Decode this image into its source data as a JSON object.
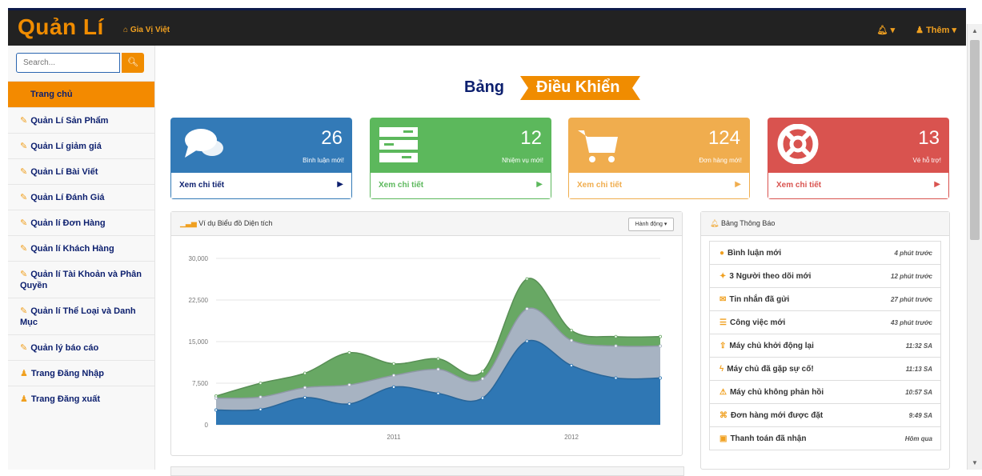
{
  "navbar": {
    "brand": "Quản Lí",
    "site_link": "Gia Vị Việt",
    "bell_label": "▾",
    "more_label": "Thêm ▾"
  },
  "sidebar": {
    "search_placeholder": "Search...",
    "items": [
      {
        "label": "Trang chủ",
        "icon": "none",
        "active": true
      },
      {
        "label": "Quản Lí Sản Phẩm",
        "icon": "edit-icon"
      },
      {
        "label": "Quản Lí giảm giá",
        "icon": "edit-icon"
      },
      {
        "label": "Quản Lí Bài Viết",
        "icon": "edit-icon"
      },
      {
        "label": "Quản Lí Đánh Giá",
        "icon": "edit-icon"
      },
      {
        "label": "Quản lí Đơn Hàng",
        "icon": "edit-icon"
      },
      {
        "label": "Quản lí Khách Hàng",
        "icon": "edit-icon"
      },
      {
        "label": "Quản lí Tài Khoản và Phân Quyền",
        "icon": "edit-icon"
      },
      {
        "label": "Quản lí Thể Loại và Danh Mục",
        "icon": "edit-icon"
      },
      {
        "label": "Quản lý báo cáo",
        "icon": "edit-icon"
      },
      {
        "label": "Trang Đăng Nhập",
        "icon": "user-icon"
      },
      {
        "label": "Trang Đăng xuất",
        "icon": "user-icon"
      }
    ]
  },
  "heading": {
    "word1": "Bảng",
    "word2": "Điều Khiển"
  },
  "cards": [
    {
      "count": "26",
      "label": "Bình luận mới!",
      "link": "Xem chi tiết",
      "color": "#337ab7",
      "icon": "comments-icon"
    },
    {
      "count": "12",
      "label": "Nhiệm vụ mới!",
      "link": "Xem chi tiết",
      "color": "#5cb85c",
      "icon": "tasks-icon"
    },
    {
      "count": "124",
      "label": "Đơn hàng mới!",
      "link": "Xem chi tiết",
      "color": "#f0ad4e",
      "icon": "cart-icon"
    },
    {
      "count": "13",
      "label": "Vé hỗ trợ!",
      "link": "Xem chi tiết",
      "color": "#d9534f",
      "icon": "support-icon"
    }
  ],
  "chart_panel": {
    "title": "Ví dụ Biểu đồ Diện tích",
    "action": "Hành động ▾"
  },
  "notif_panel": {
    "title": "Bảng Thông Báo",
    "items": [
      {
        "text": "Bình luận mới",
        "time": "4 phút trước",
        "icon": "comment-icon"
      },
      {
        "text": "3 Người theo dõi mới",
        "time": "12 phút trước",
        "icon": "twitter-icon"
      },
      {
        "text": "Tin nhắn đã gửi",
        "time": "27 phút trước",
        "icon": "envelope-icon"
      },
      {
        "text": "Công việc mới",
        "time": "43 phút trước",
        "icon": "tasks-icon"
      },
      {
        "text": "Máy chủ khởi động lại",
        "time": "11:32 SA",
        "icon": "upload-icon"
      },
      {
        "text": "Máy chủ đã gặp sự cố!",
        "time": "11:13 SA",
        "icon": "bolt-icon"
      },
      {
        "text": "Máy chủ không phản hồi",
        "time": "10:57 SA",
        "icon": "warning-icon"
      },
      {
        "text": "Đơn hàng mới được đặt",
        "time": "9:49 SA",
        "icon": "cart-icon"
      },
      {
        "text": "Thanh toán đã nhận",
        "time": "Hôm qua",
        "icon": "money-icon"
      }
    ]
  },
  "chart_data": {
    "type": "area",
    "x": [
      2010.0,
      2010.25,
      2010.5,
      2010.75,
      2011.0,
      2011.25,
      2011.5,
      2011.75,
      2012.0,
      2012.25,
      2012.5
    ],
    "x_tick_labels": [
      {
        "x": 2011.0,
        "label": "2011"
      },
      {
        "x": 2012.0,
        "label": "2012"
      }
    ],
    "ylim": [
      0,
      30000
    ],
    "y_ticks": [
      "0",
      "7,500",
      "15,000",
      "22,500",
      "30,000"
    ],
    "grid": true,
    "series": [
      {
        "color": "#2f77b4",
        "values": [
          2666,
          2778,
          4912,
          3767,
          6810,
          5670,
          4820,
          15073,
          10687,
          8432,
          8432
        ]
      },
      {
        "color": "#a7b3c2",
        "values": [
          4800,
          5000,
          6700,
          7200,
          8900,
          10000,
          8300,
          20900,
          15200,
          14200,
          14200
        ]
      },
      {
        "color": "#68a864",
        "values": [
          5200,
          7500,
          9300,
          13000,
          11000,
          11900,
          9600,
          26300,
          17000,
          15900,
          15900
        ]
      }
    ]
  }
}
